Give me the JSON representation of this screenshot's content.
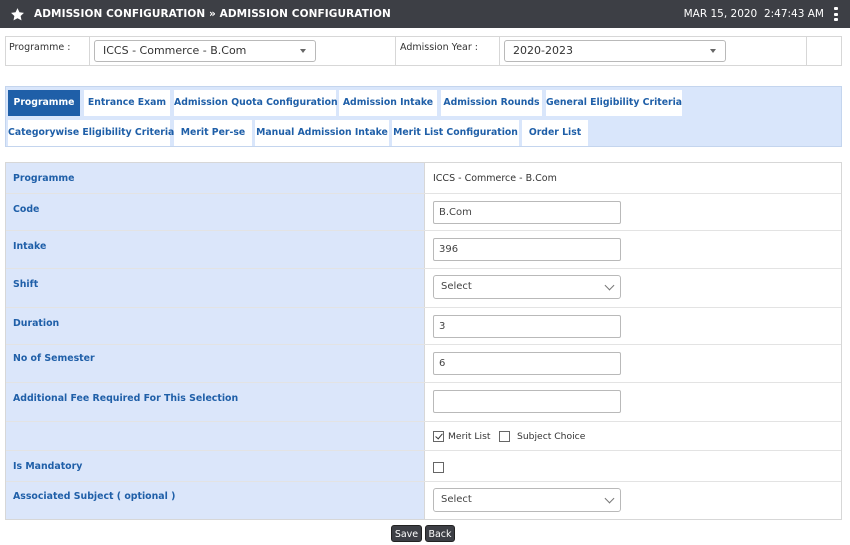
{
  "header": {
    "title": "ADMISSION CONFIGURATION » ADMISSION CONFIGURATION",
    "date": "MAR 15, 2020",
    "time": "2:47:43 AM"
  },
  "selectors": {
    "programme_label": "Programme :",
    "programme_value": "ICCS - Commerce - B.Com",
    "year_label": "Admission Year :",
    "year_value": "2020-2023"
  },
  "tabs": [
    {
      "label": "Programme",
      "active": true
    },
    {
      "label": "Entrance Exam",
      "active": false
    },
    {
      "label": "Admission Quota Configuration",
      "active": false
    },
    {
      "label": "Admission Intake",
      "active": false
    },
    {
      "label": "Admission Rounds",
      "active": false
    },
    {
      "label": "General Eligibility Criteria",
      "active": false
    },
    {
      "label": "Categorywise Eligibility Criteria",
      "active": false
    },
    {
      "label": "Merit Per-se",
      "active": false
    },
    {
      "label": "Manual Admission Intake",
      "active": false
    },
    {
      "label": "Merit List Configuration",
      "active": false
    },
    {
      "label": "Order List",
      "active": false
    }
  ],
  "form": {
    "programme_label": "Programme",
    "programme_value": "ICCS - Commerce - B.Com",
    "code_label": "Code",
    "code_value": "B.Com",
    "intake_label": "Intake",
    "intake_value": "396",
    "shift_label": "Shift",
    "shift_value": "Select",
    "duration_label": "Duration",
    "duration_value": "3",
    "semester_label": "No of Semester",
    "semester_value": "6",
    "fee_label": "Additional Fee Required For This Selection",
    "fee_value": "",
    "merit_list_label": "Merit List",
    "merit_list_checked": true,
    "subject_choice_label": "Subject Choice",
    "subject_choice_checked": false,
    "mandatory_label": "Is Mandatory",
    "mandatory_checked": false,
    "assoc_label": "Associated Subject ( optional )",
    "assoc_value": "Select"
  },
  "buttons": {
    "save": "Save",
    "back": "Back"
  },
  "colors": {
    "header_bg": "#3d3f45",
    "accent": "#1f5fa8",
    "tab_strip_bg": "#d9e6fb",
    "label_cell_bg": "#dbe6fa"
  }
}
